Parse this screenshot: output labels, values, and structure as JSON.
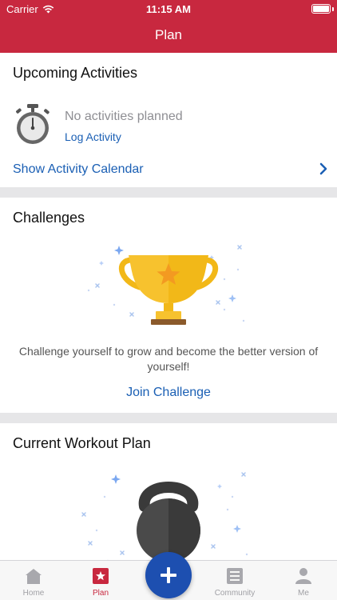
{
  "status_bar": {
    "carrier": "Carrier",
    "time": "11:15 AM"
  },
  "nav": {
    "title": "Plan"
  },
  "upcoming": {
    "title": "Upcoming Activities",
    "empty_text": "No activities planned",
    "log_link": "Log Activity",
    "calendar_link": "Show Activity Calendar"
  },
  "challenges": {
    "title": "Challenges",
    "description": "Challenge yourself to grow and become the better version of yourself!",
    "join_link": "Join Challenge"
  },
  "workout": {
    "title": "Current Workout Plan"
  },
  "tabbar": {
    "items": [
      {
        "label": "Home",
        "icon": "home-icon"
      },
      {
        "label": "Plan",
        "icon": "star-icon"
      },
      {
        "label": "",
        "icon": "plus-icon"
      },
      {
        "label": "Community",
        "icon": "newspaper-icon"
      },
      {
        "label": "Me",
        "icon": "person-icon"
      }
    ]
  },
  "colors": {
    "brand": "#c8283f",
    "link": "#1a5fb4",
    "fab": "#1d4fb0",
    "trophy": "#f7c22e"
  }
}
